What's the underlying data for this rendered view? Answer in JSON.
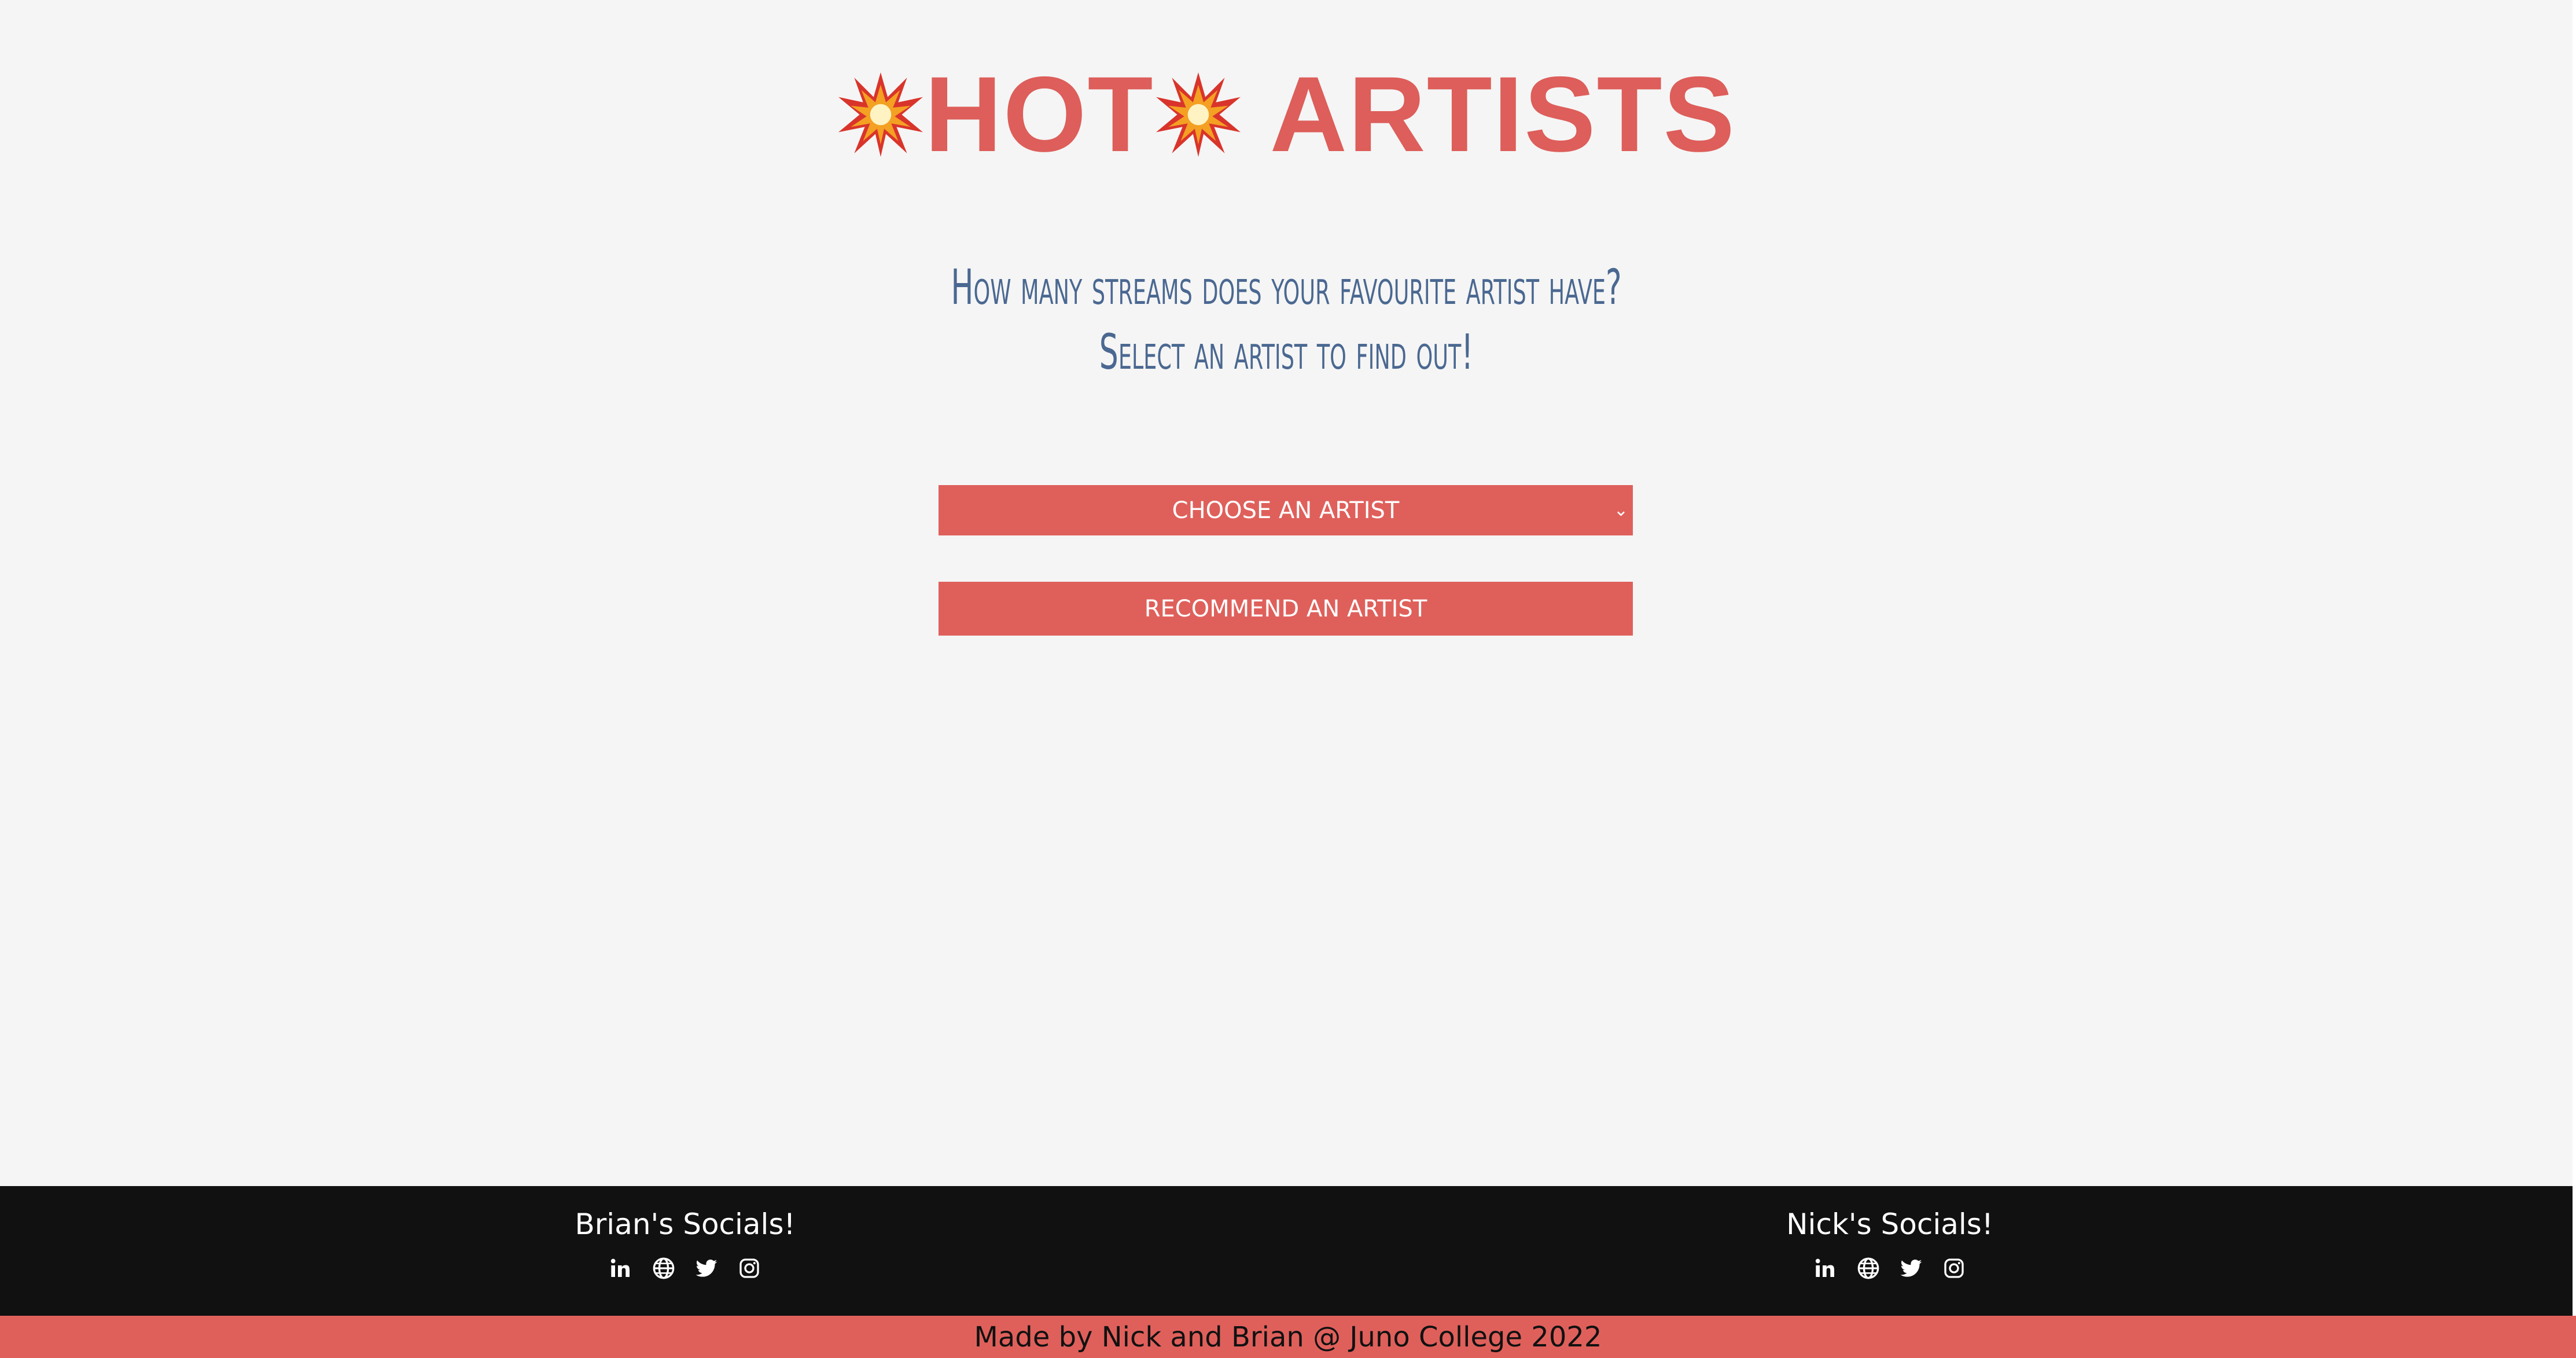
{
  "header": {
    "title_hot": "HOT",
    "title_artists": "ARTISTS",
    "burst_icon": "collision-burst-icon"
  },
  "intro": {
    "line1": "How many streams does your favourite artist have?",
    "line2": "Select an artist to find out!"
  },
  "controls": {
    "select_label": "CHOOSE AN ARTIST",
    "recommend_label": "RECOMMEND AN ARTIST"
  },
  "footer": {
    "brian_heading": "Brian's Socials!",
    "nick_heading": "Nick's Socials!",
    "icons": [
      "linkedin-icon",
      "globe-icon",
      "twitter-icon",
      "instagram-icon"
    ],
    "credit": "Made by Nick and Brian @ Juno College 2022"
  },
  "colors": {
    "accent": "#df605b",
    "heading_blue": "#4a6891",
    "background": "#f5f5f5",
    "footer_bg": "#111111"
  }
}
